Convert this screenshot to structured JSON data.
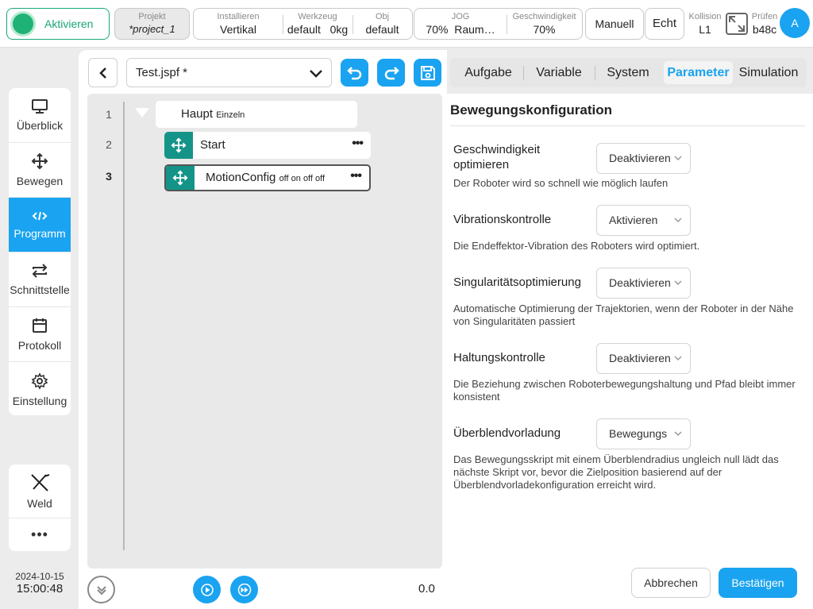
{
  "topbar": {
    "activate_label": "Aktivieren",
    "project": {
      "caption": "Projekt",
      "value": "*project_1"
    },
    "install": [
      {
        "caption": "Installieren",
        "value": "Vertikal"
      },
      {
        "caption": "Werkzeug",
        "value": "default   0kg"
      },
      {
        "caption": "Obj",
        "value": "default"
      }
    ],
    "jog": [
      {
        "caption": "JOG",
        "value": "70%  Raum…"
      },
      {
        "caption": "Geschwindigkeit",
        "value": "70%"
      }
    ],
    "manual_label": "Manuell",
    "echt_label": "Echt",
    "collision": {
      "caption": "Kollision",
      "value": "L1"
    },
    "check": {
      "caption": "Prüfen",
      "value": "b48c"
    },
    "avatar_letter": "A"
  },
  "nav": {
    "items": [
      {
        "label": "Überblick",
        "icon": "monitor-icon"
      },
      {
        "label": "Bewegen",
        "icon": "move-arrows-icon"
      },
      {
        "label": "Programm",
        "icon": "code-icon",
        "active": true
      },
      {
        "label": "Schnittstelle",
        "icon": "swap-arrows-icon"
      },
      {
        "label": "Protokoll",
        "icon": "calendar-icon"
      },
      {
        "label": "Einstellung",
        "icon": "gear-icon"
      }
    ],
    "weld_label": "Weld",
    "more_label": "•••"
  },
  "datetime": {
    "date": "2024-10-15",
    "time": "15:00:48"
  },
  "editor": {
    "file_name": "Test.jspf *",
    "line_numbers": [
      "1",
      "2",
      "3"
    ],
    "main_node": {
      "label": "Haupt",
      "sub": "Einzeln"
    },
    "nodes": [
      {
        "label": "Start",
        "sub": ""
      },
      {
        "label": "MotionConfig",
        "sub": "off on off off"
      }
    ],
    "more_glyph": "•••",
    "time_readout": "0.0"
  },
  "tabs": [
    {
      "label": "Aufgabe"
    },
    {
      "label": "Variable"
    },
    {
      "label": "System"
    },
    {
      "label": "Parameter",
      "active": true
    },
    {
      "label": "Simulation"
    }
  ],
  "panel": {
    "title": "Bewegungskonfiguration",
    "params": [
      {
        "label": "Geschwindigkeit optimieren",
        "value": "Deaktivieren",
        "description": "Der Roboter wird so schnell wie möglich laufen"
      },
      {
        "label": "Vibrationskontrolle",
        "value": "Aktivieren",
        "description": "Die Endeffektor-Vibration des Roboters wird optimiert."
      },
      {
        "label": "Singularitätsoptimierung",
        "value": "Deaktivieren",
        "description": "Automatische Optimierung der Trajektorien, wenn der Roboter in der Nähe von Singularitäten passiert"
      },
      {
        "label": "Haltungskontrolle",
        "value": "Deaktivieren",
        "description": "Die Beziehung zwischen Roboterbewegungshaltung und Pfad bleibt immer konsistent"
      },
      {
        "label": "Überblendvorladung",
        "value": "Bewegungs",
        "description": "Das Bewegungsskript mit einem Überblendradius ungleich null lädt das nächste Skript vor, bevor die Zielposition basierend auf der Überblendvorladekonfiguration erreicht wird."
      }
    ],
    "cancel_label": "Abbrechen",
    "confirm_label": "Bestätigen"
  },
  "colors": {
    "accent": "#1aa3f0",
    "active_green": "#1fb277",
    "node_handle": "#149488"
  }
}
